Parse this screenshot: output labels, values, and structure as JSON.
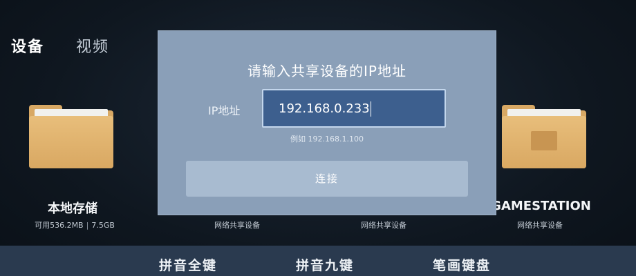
{
  "tabs": {
    "devices": "设备",
    "video": "视频"
  },
  "devices": [
    {
      "name": "本地存储",
      "available": "可用536.2MB",
      "total": "7.5GB"
    },
    {
      "name": "",
      "subtitle": "网络共享设备"
    },
    {
      "name": "",
      "subtitle": "网络共享设备"
    },
    {
      "name": "GAMESTATION",
      "subtitle": "网络共享设备"
    }
  ],
  "dialog": {
    "title": "请输入共享设备的IP地址",
    "ip_label": "IP地址",
    "ip_value": "192.168.0.233",
    "example": "例如 192.168.1.100",
    "connect_label": "连接"
  },
  "keyboard": {
    "pinyin_full": "拼音全键",
    "pinyin_nine": "拼音九键",
    "stroke": "笔画键盘"
  },
  "colors": {
    "dialog_bg": "#8a9fb8",
    "input_bg": "#3d5f8e",
    "folder": "#d8a864"
  }
}
